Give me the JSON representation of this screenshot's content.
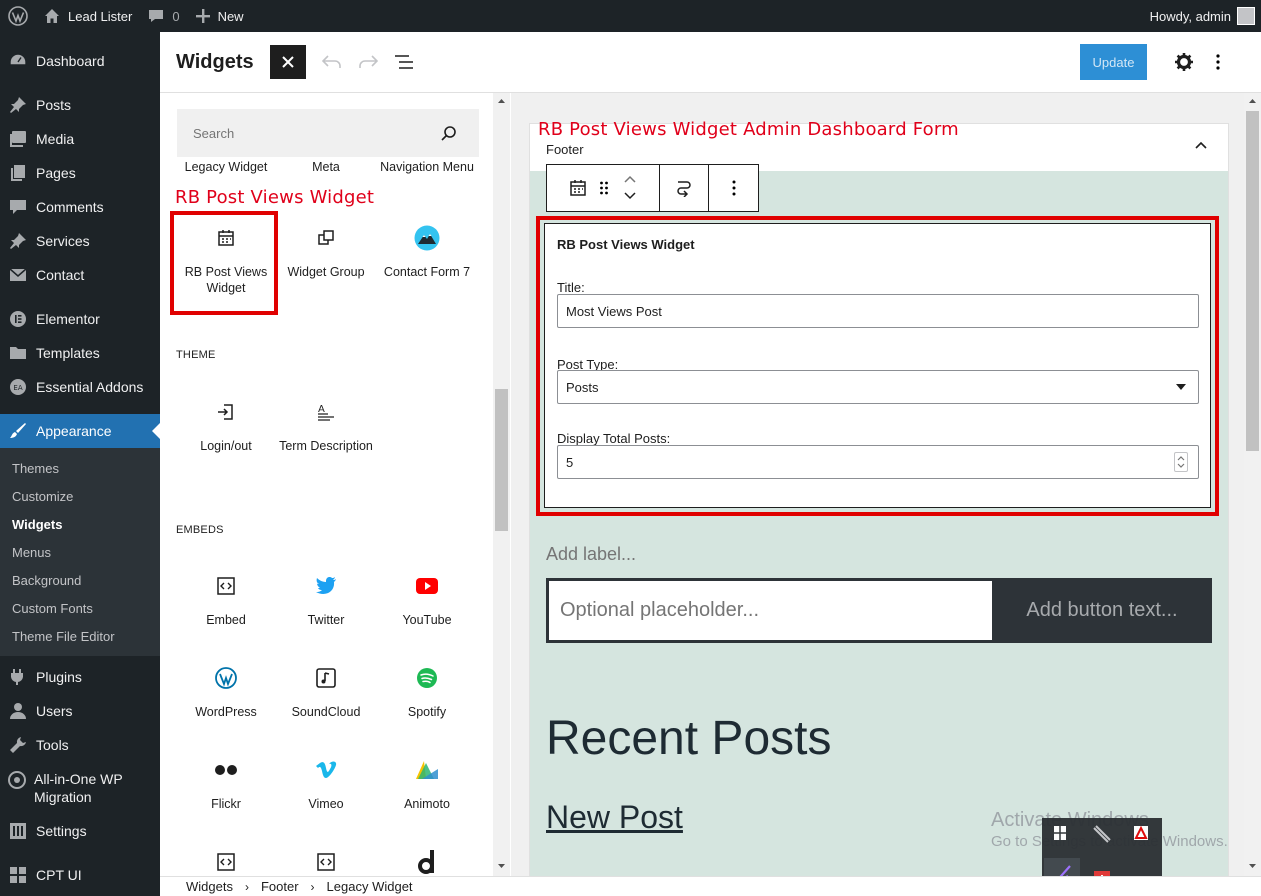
{
  "admin_bar": {
    "site_name": "Lead Lister",
    "comments_count": "0",
    "new_label": "New",
    "howdy": "Howdy, admin"
  },
  "sidebar": {
    "items": [
      {
        "label": "Dashboard",
        "icon": "dashboard-icon"
      },
      {
        "label": "Posts",
        "icon": "pin-icon"
      },
      {
        "label": "Media",
        "icon": "media-icon"
      },
      {
        "label": "Pages",
        "icon": "pages-icon"
      },
      {
        "label": "Comments",
        "icon": "comments-icon"
      },
      {
        "label": "Services",
        "icon": "pin-icon"
      },
      {
        "label": "Contact",
        "icon": "mail-icon"
      },
      {
        "label": "Elementor",
        "icon": "elementor-icon"
      },
      {
        "label": "Templates",
        "icon": "folder-icon"
      },
      {
        "label": "Essential Addons",
        "icon": "ea-icon"
      },
      {
        "label": "Appearance",
        "icon": "brush-icon"
      },
      {
        "label": "Plugins",
        "icon": "plugin-icon"
      },
      {
        "label": "Users",
        "icon": "users-icon"
      },
      {
        "label": "Tools",
        "icon": "wrench-icon"
      },
      {
        "label": "All-in-One WP Migration",
        "icon": "migration-icon"
      },
      {
        "label": "Settings",
        "icon": "settings-icon"
      },
      {
        "label": "CPT UI",
        "icon": "cpt-icon"
      }
    ],
    "submenu": [
      "Themes",
      "Customize",
      "Widgets",
      "Menus",
      "Background",
      "Custom Fonts",
      "Theme File Editor"
    ]
  },
  "header": {
    "title": "Widgets",
    "update_label": "Update"
  },
  "inserter": {
    "search_placeholder": "Search",
    "top_row": [
      "Legacy Widget",
      "Meta",
      "Navigation Menu"
    ],
    "annotation": "RB Post Views Widget",
    "row1": [
      "RB Post Views Widget",
      "Widget Group",
      "Contact Form 7"
    ],
    "theme_label": "THEME",
    "theme_row": [
      "Login/out",
      "Term Description"
    ],
    "embeds_label": "EMBEDS",
    "embeds": [
      "Embed",
      "Twitter",
      "YouTube",
      "WordPress",
      "SoundCloud",
      "Spotify",
      "Flickr",
      "Vimeo",
      "Animoto"
    ]
  },
  "canvas": {
    "annotation": "RB Post Views Widget Admin Dashboard Form",
    "area_label": "Footer",
    "widget": {
      "title": "RB Post Views Widget",
      "title_label": "Title:",
      "title_value": "Most Views Post",
      "post_type_label": "Post Type:",
      "post_type_value": "Posts",
      "total_label": "Display Total Posts:",
      "total_value": "5"
    },
    "add_label": "Add label...",
    "search_placeholder": "Optional placeholder...",
    "button_text": "Add button text...",
    "recent_heading": "Recent Posts",
    "new_post": "New Post",
    "watermark_1": "Activate Windows",
    "watermark_2": "Go to Settings to activate Windows."
  },
  "footer": {
    "breadcrumbs": [
      "Widgets",
      "Footer",
      "Legacy Widget"
    ]
  },
  "colors": {
    "admin_dark": "#1d2327",
    "accent": "#2271b1",
    "annotation_red": "#e00000",
    "canvas_bg": "#d5e5df"
  }
}
